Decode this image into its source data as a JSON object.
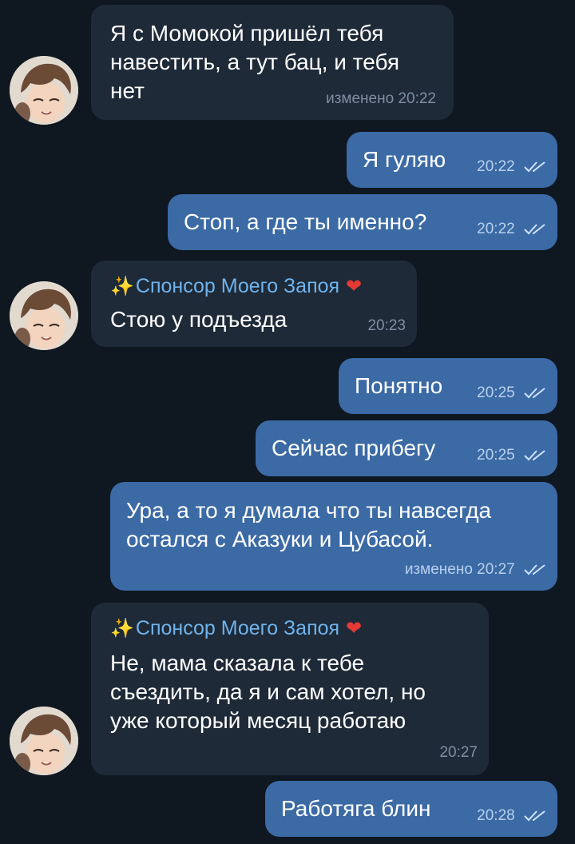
{
  "theme": {
    "background": "#0f1720",
    "incoming_bubble": "#1e2a38",
    "outgoing_bubble": "#3b6aa5",
    "sender_name_color": "#6fb3ec",
    "heart_color": "#e53935"
  },
  "messages": [
    {
      "direction": "in",
      "text": "Я с Момокой пришёл тебя\nнавестить, а тут бац, и тебя\nнет",
      "meta": "изменено 20:22",
      "avatar": "avatar-anime-boy"
    },
    {
      "direction": "out",
      "text": "Я гуляю",
      "meta": "20:22",
      "status": "double-check-icon"
    },
    {
      "direction": "out",
      "text": "Стоп, а где ты именно?",
      "meta": "20:22",
      "status": "double-check-icon"
    },
    {
      "direction": "in",
      "sender": "Спонсор Моего Запоя",
      "sender_prefix_icon": "sparkles-icon",
      "sender_suffix_icon": "heart-icon",
      "text": "Стою у подъезда",
      "meta": "20:23",
      "avatar": "avatar-anime-boy"
    },
    {
      "direction": "out",
      "text": "Понятно",
      "meta": "20:25",
      "status": "double-check-icon"
    },
    {
      "direction": "out",
      "text": "Сейчас прибегу",
      "meta": "20:25",
      "status": "double-check-icon"
    },
    {
      "direction": "out",
      "text": "Ура, а то я думала что ты навсегда\nостался с Аказуки и Цубасой.",
      "meta": "изменено 20:27",
      "status": "double-check-icon"
    },
    {
      "direction": "in",
      "sender": "Спонсор Моего Запоя",
      "sender_prefix_icon": "sparkles-icon",
      "sender_suffix_icon": "heart-icon",
      "text": "Не, мама сказала к тебе\nсъездить, да я и сам хотел, но\nуже который месяц работаю",
      "meta": "20:27",
      "avatar": "avatar-anime-boy"
    },
    {
      "direction": "out",
      "text": "Работяга блин",
      "meta": "20:28",
      "status": "double-check-icon"
    }
  ]
}
